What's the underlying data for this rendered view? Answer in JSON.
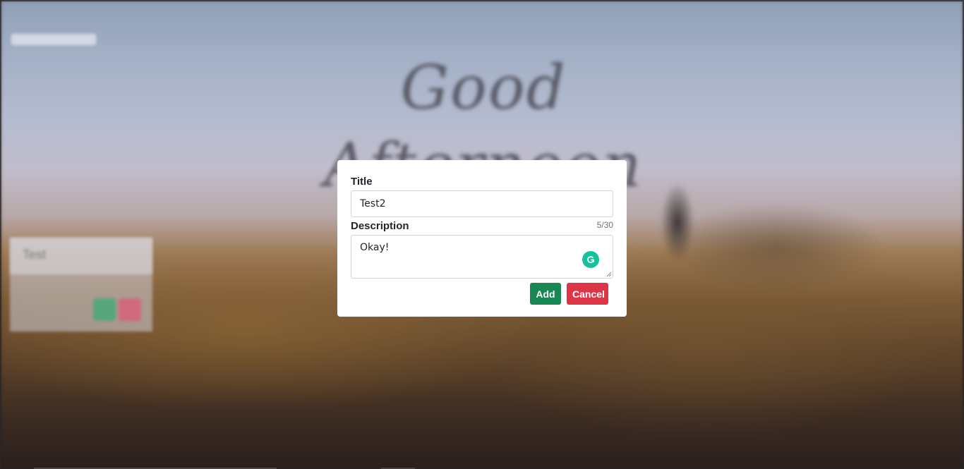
{
  "background": {
    "greeting": "Good Afternoon",
    "note": {
      "title": "Test"
    }
  },
  "modal": {
    "title_label": "Title",
    "title_value": "Test2",
    "description_label": "Description",
    "description_counter": "5/30",
    "description_value": "Okay!",
    "add_label": "Add",
    "cancel_label": "Cancel",
    "grammarly_icon": "grammarly-icon"
  },
  "colors": {
    "add": "#198754",
    "cancel": "#dc3545",
    "grammarly": "#15c39a"
  }
}
